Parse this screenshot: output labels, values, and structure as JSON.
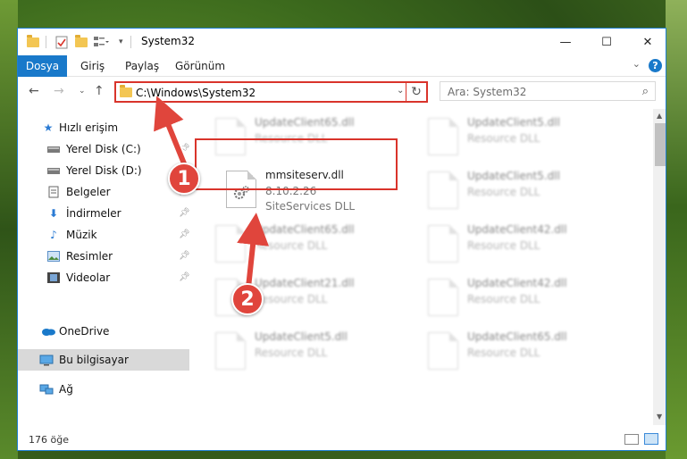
{
  "window": {
    "title": "System32",
    "controls": {
      "minimize": "—",
      "maximize": "☐",
      "close": "✕"
    }
  },
  "ribbon": {
    "tabs": [
      {
        "label": "Dosya",
        "active": true
      },
      {
        "label": "Giriş"
      },
      {
        "label": "Paylaş"
      },
      {
        "label": "Görünüm"
      }
    ],
    "help": "?"
  },
  "nav": {
    "address": "C:\\Windows\\System32",
    "search_placeholder": "Ara: System32"
  },
  "sidebar": {
    "items": [
      {
        "label": "Hızlı erişim",
        "icon": "star-icon",
        "pinned": false
      },
      {
        "label": "Yerel Disk (C:)",
        "icon": "drive-icon",
        "pinned": true
      },
      {
        "label": "Yerel Disk (D:)",
        "icon": "drive-icon",
        "pinned": true
      },
      {
        "label": "Belgeler",
        "icon": "documents-icon",
        "pinned": true
      },
      {
        "label": "İndirmeler",
        "icon": "downloads-icon",
        "pinned": true
      },
      {
        "label": "Müzik",
        "icon": "music-icon",
        "pinned": true
      },
      {
        "label": "Resimler",
        "icon": "pictures-icon",
        "pinned": true
      },
      {
        "label": "Videolar",
        "icon": "videos-icon",
        "pinned": true
      },
      {
        "label": "OneDrive",
        "icon": "cloud-icon",
        "pinned": false
      },
      {
        "label": "Bu bilgisayar",
        "icon": "computer-icon",
        "selected": true
      },
      {
        "label": "Ağ",
        "icon": "network-icon",
        "pinned": false
      }
    ]
  },
  "files": {
    "selected": {
      "name": "mmsiteserv.dll",
      "version": "8.10.2.26",
      "description": "SiteServices DLL"
    },
    "background": [
      {
        "name": "UpdateClient65.dll",
        "type": "Resource DLL"
      },
      {
        "name": "UpdateClient5.dll",
        "type": "Resource DLL"
      },
      {
        "name": "UpdateClient5.dll",
        "type": "Resource DLL"
      },
      {
        "name": "UpdateClient65.dll",
        "type": "Resource DLL"
      },
      {
        "name": "UpdateClient42.dll",
        "type": "Resource DLL"
      },
      {
        "name": "UpdateClient21.dll",
        "type": "Resource DLL"
      },
      {
        "name": "UpdateClient42.dll",
        "type": "Resource DLL"
      },
      {
        "name": "UpdateClient5.dll",
        "type": "Resource DLL"
      },
      {
        "name": "UpdateClient65.dll",
        "type": "Resource DLL"
      }
    ]
  },
  "status": {
    "count": "176 öğe"
  },
  "annotations": {
    "step1": "1",
    "step2": "2",
    "color": "#e0453c"
  }
}
